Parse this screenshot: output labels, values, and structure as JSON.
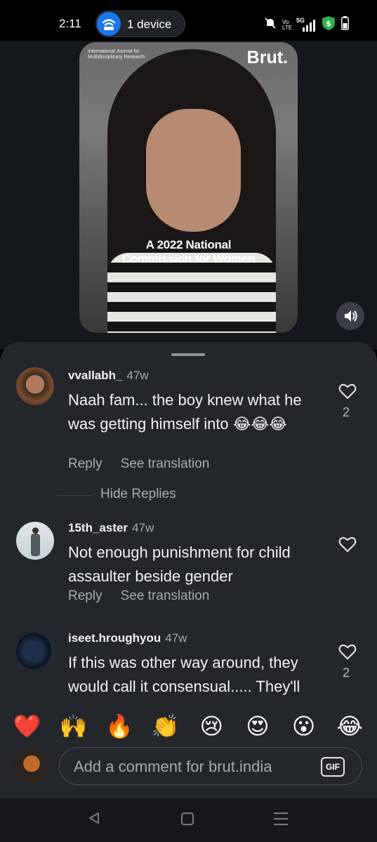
{
  "status_bar": {
    "time": "2:11",
    "device_pill_label": "1 device",
    "icons": [
      "mute-icon",
      "volte-icon",
      "5g-signal-icon",
      "shield-dollar-icon",
      "battery-icon"
    ],
    "volte_text": "Vo LTE",
    "network_text": "5G"
  },
  "video": {
    "journal_text": "International Journal for Multidisciplinary Research",
    "brand": "Brut.",
    "caption_line1": "A 2022 National",
    "caption_line2": "Commission for Women"
  },
  "comments": [
    {
      "username": "vvallabh_",
      "age": "47w",
      "text": "Naah fam... the boy knew what he was getting himself into 😂😂😂",
      "reply_label": "Reply",
      "translate_label": "See translation",
      "likes": "2"
    },
    {
      "username": "15th_aster",
      "age": "47w",
      "text": "Not enough punishment for child assaulter beside gender",
      "reply_label": "Reply",
      "translate_label": "See translation",
      "likes": ""
    },
    {
      "username": "iseet.hroughyou",
      "age": "47w",
      "text": "If this was other way around, they would call it consensual..... They'll say why did the girl go",
      "likes": "2"
    }
  ],
  "hide_replies_label": "Hide Replies",
  "emoji_bar": [
    "❤️",
    "🙌",
    "🔥",
    "👏",
    "😢",
    "😍",
    "😮",
    "😂"
  ],
  "comment_input": {
    "placeholder": "Add a comment for brut.india",
    "gif_label": "GIF"
  },
  "colors": {
    "sheet_bg": "#23262b",
    "accent_blue": "#1976f2",
    "secondary_text": "#a7abb0"
  }
}
